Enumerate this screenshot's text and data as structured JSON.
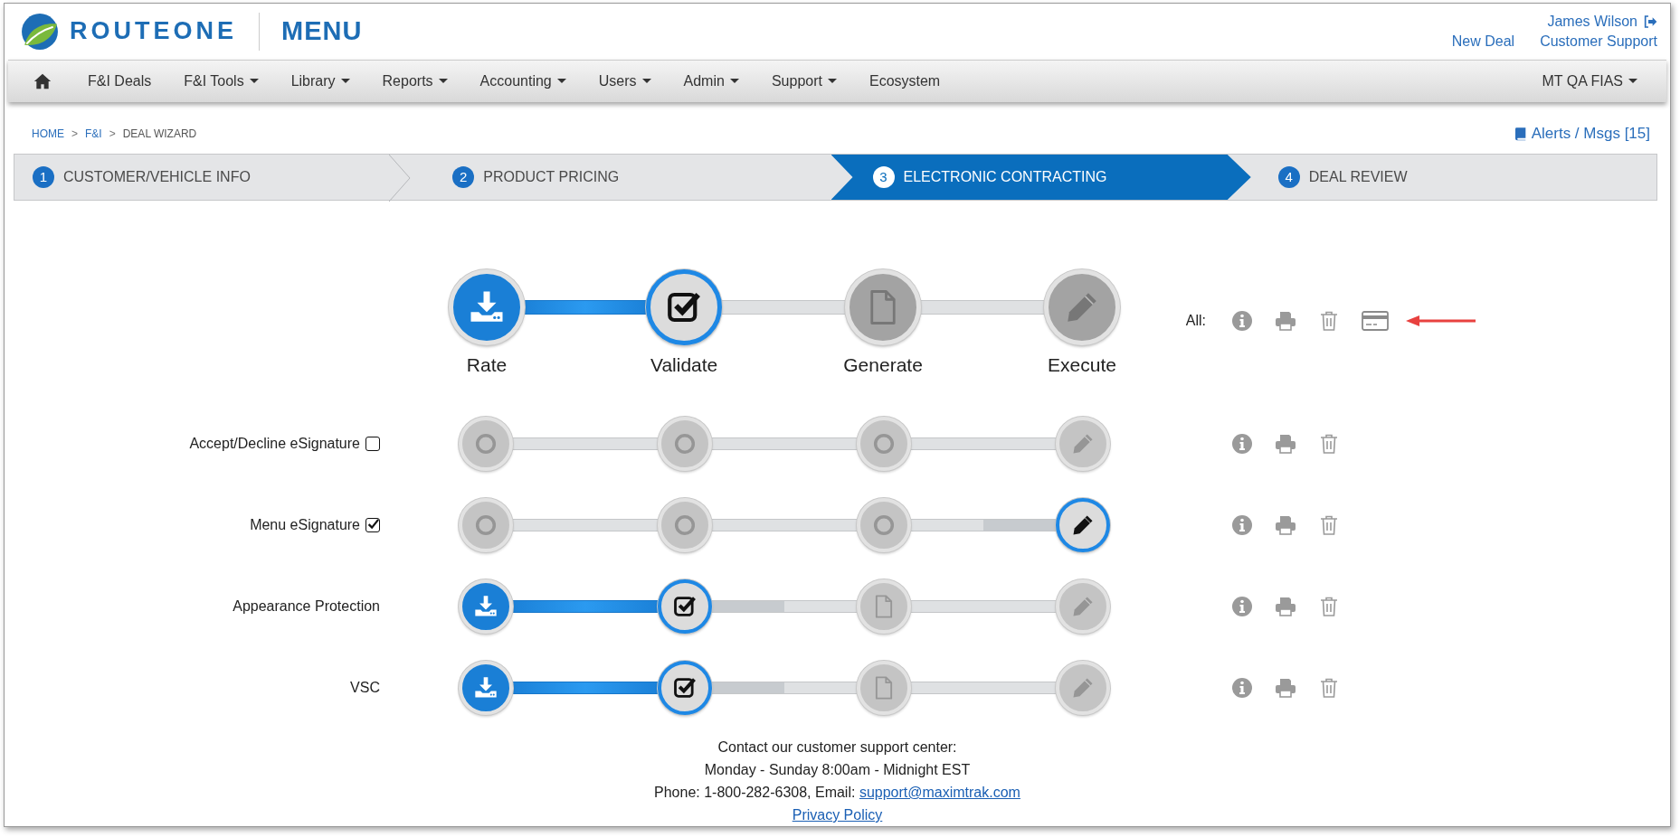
{
  "header": {
    "brand": "ROUTEONE",
    "product": "MENU",
    "user": "James Wilson",
    "links": [
      "New Deal",
      "Customer Support"
    ]
  },
  "nav": {
    "items": [
      {
        "label": "F&I Deals",
        "dropdown": false
      },
      {
        "label": "F&I Tools",
        "dropdown": true
      },
      {
        "label": "Library",
        "dropdown": true
      },
      {
        "label": "Reports",
        "dropdown": true
      },
      {
        "label": "Accounting",
        "dropdown": true
      },
      {
        "label": "Users",
        "dropdown": true
      },
      {
        "label": "Admin",
        "dropdown": true
      },
      {
        "label": "Support",
        "dropdown": true
      },
      {
        "label": "Ecosystem",
        "dropdown": false
      }
    ],
    "account": {
      "label": "MT QA FIAS",
      "dropdown": true
    }
  },
  "breadcrumb": [
    {
      "label": "HOME",
      "link": true
    },
    {
      "label": "F&I",
      "link": true
    },
    {
      "label": "DEAL WIZARD",
      "link": false
    }
  ],
  "breadcrumb_separators": [
    ">",
    ">"
  ],
  "alerts": "Alerts / Msgs [15]",
  "wizard_steps": [
    {
      "number": "1",
      "label": "CUSTOMER/VEHICLE INFO",
      "selected": false
    },
    {
      "number": "2",
      "label": "PRODUCT PRICING",
      "selected": false
    },
    {
      "number": "3",
      "label": "ELECTRONIC CONTRACTING",
      "selected": true
    },
    {
      "number": "4",
      "label": "DEAL REVIEW",
      "selected": false
    }
  ],
  "stages": {
    "nodes": [
      {
        "label": "Rate",
        "kind": "download",
        "done": true,
        "current": false
      },
      {
        "label": "Validate",
        "kind": "check",
        "done": false,
        "current": true
      },
      {
        "label": "Generate",
        "kind": "file",
        "done": false,
        "current": false
      },
      {
        "label": "Execute",
        "kind": "pencil",
        "done": false,
        "current": false
      }
    ],
    "connectors": [
      {
        "kind": "complete"
      },
      {
        "kind": "empty"
      },
      {
        "kind": "empty"
      }
    ],
    "all_label": "All:"
  },
  "rows": [
    {
      "label": "Accept/Decline eSignature",
      "checkbox": {
        "checked": false
      },
      "nodes": [
        {
          "kind": "circle",
          "done": false,
          "current": false
        },
        {
          "kind": "circle",
          "done": false,
          "current": false
        },
        {
          "kind": "circle",
          "done": false,
          "current": false
        },
        {
          "kind": "pencil",
          "done": false,
          "current": false
        }
      ],
      "connectors": [
        {
          "kind": "empty"
        },
        {
          "kind": "empty"
        },
        {
          "kind": "empty"
        }
      ]
    },
    {
      "label": "Menu eSignature",
      "checkbox": {
        "checked": true
      },
      "nodes": [
        {
          "kind": "circle",
          "done": false,
          "current": false
        },
        {
          "kind": "circle",
          "done": false,
          "current": false
        },
        {
          "kind": "circle",
          "done": false,
          "current": false
        },
        {
          "kind": "pencil",
          "done": false,
          "current": true
        }
      ],
      "connectors": [
        {
          "kind": "empty"
        },
        {
          "kind": "empty"
        },
        {
          "kind": "lead-in"
        }
      ]
    },
    {
      "label": "Appearance Protection",
      "nodes": [
        {
          "kind": "download",
          "done": true,
          "current": false
        },
        {
          "kind": "check",
          "done": false,
          "current": true
        },
        {
          "kind": "file",
          "done": false,
          "current": false
        },
        {
          "kind": "pencil",
          "done": false,
          "current": false
        }
      ],
      "connectors": [
        {
          "kind": "complete"
        },
        {
          "kind": "lead-out"
        },
        {
          "kind": "empty"
        }
      ]
    },
    {
      "label": "VSC",
      "nodes": [
        {
          "kind": "download",
          "done": true,
          "current": false
        },
        {
          "kind": "check",
          "done": false,
          "current": true
        },
        {
          "kind": "file",
          "done": false,
          "current": false
        },
        {
          "kind": "pencil",
          "done": false,
          "current": false
        }
      ],
      "connectors": [
        {
          "kind": "complete"
        },
        {
          "kind": "lead-out"
        },
        {
          "kind": "empty"
        }
      ]
    }
  ],
  "footer": {
    "lines": [
      "Contact our customer support center:",
      "Monday - Sunday 8:00am - Midnight EST"
    ],
    "phone_text": "Phone: 1-800-282-6308, Email:",
    "email": "support@maximtrak.com",
    "privacy": "Privacy Policy"
  }
}
